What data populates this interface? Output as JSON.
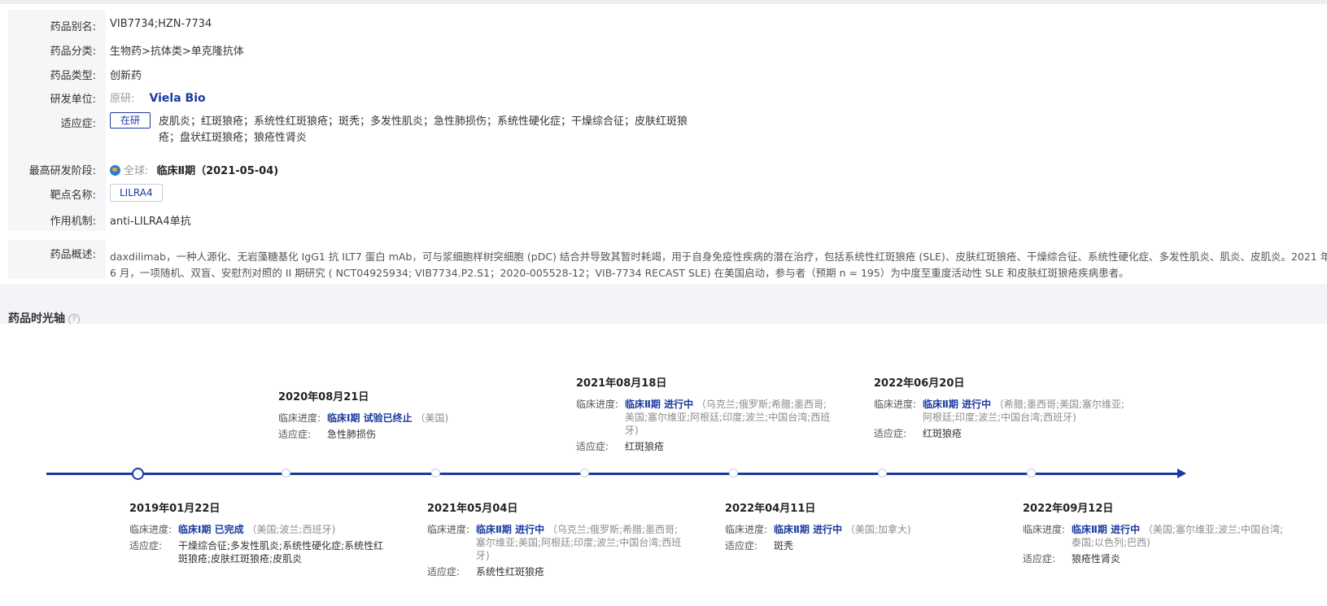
{
  "info": {
    "alias": {
      "label": "药品别名:",
      "value": "VIB7734;HZN-7734"
    },
    "category": {
      "label": "药品分类:",
      "value": "生物药>抗体类>单克隆抗体"
    },
    "type": {
      "label": "药品类型:",
      "value": "创新药"
    },
    "developer": {
      "label": "研发单位:",
      "prefix": "原研:",
      "name": "Viela Bio"
    },
    "indication": {
      "label": "适应症:",
      "tag": "在研",
      "line1": "皮肌炎；红斑狼疮；系统性红斑狼疮；斑秃；多发性肌炎；急性肺损伤；系统性硬化症；干燥综合征；皮肤红斑狼",
      "line2": "疮；盘状红斑狼疮；狼疮性肾炎"
    },
    "phase": {
      "label": "最高研发阶段:",
      "region": "全球:",
      "value": "临床Ⅱ期（2021-05-04)"
    },
    "target": {
      "label": "靶点名称:",
      "value": "LILRA4"
    },
    "mechanism": {
      "label": "作用机制:",
      "value": "anti-LILRA4单抗"
    },
    "overview": {
      "label": "药品概述:",
      "line1": "daxdilimab，一种人源化、无岩藻糖基化 IgG1 抗 ILT7 蛋白 mAb，可与浆细胞样树突细胞 (pDC) 结合并导致其暂时耗竭，用于自身免疫性疾病的潜在治疗，包括系统性红斑狼疮 (SLE)、皮肤红斑狼疮、干燥综合征、系统性硬化症、多发性肌炎、肌炎、皮肌炎。2021 年",
      "line2": "6 月，一项随机、双盲、安慰剂对照的 II 期研究 ( NCT04925934; VIB7734.P2.S1；2020-005528-12；VIB-7734 RECAST SLE) 在美国启动，参与者（预期 n = 195）为中度至重度活动性 SLE 和皮肤红斑狼疮疾病患者。"
    }
  },
  "timeline": {
    "title": "药品时光轴",
    "progress_label": "临床进度:",
    "indication_label": "适应症:",
    "events": [
      {
        "date": "2019年01月22日",
        "stage": "临床Ⅰ期 已完成",
        "countries": "（美国;波兰;西班牙)",
        "indication": "干燥综合征;多发性肌炎;系统性硬化症;系统性红斑狼疮;皮肤红斑狼疮;皮肌炎"
      },
      {
        "date": "2020年08月21日",
        "stage": "临床Ⅰ期 试验已终止",
        "countries": "（美国)",
        "indication": "急性肺损伤"
      },
      {
        "date": "2021年05月04日",
        "stage": "临床Ⅱ期 进行中",
        "countries": "（乌克兰;俄罗斯;希腊;墨西哥;塞尔维亚;美国;阿根廷;印度;波兰;中国台湾;西班牙)",
        "indication": "系统性红斑狼疮"
      },
      {
        "date": "2021年08月18日",
        "stage": "临床Ⅱ期 进行中",
        "countries": "（乌克兰;俄罗斯;希腊;墨西哥;美国;塞尔维亚;阿根廷;印度;波兰;中国台湾;西班牙)",
        "indication": "红斑狼疮"
      },
      {
        "date": "2022年04月11日",
        "stage": "临床Ⅱ期 进行中",
        "countries": "（美国;加拿大)",
        "indication": "斑秃"
      },
      {
        "date": "2022年06月20日",
        "stage": "临床Ⅱ期 进行中",
        "countries": "（希腊;墨西哥;美国;塞尔维亚;阿根廷;印度;波兰;中国台湾;西班牙)",
        "indication": "红斑狼疮"
      },
      {
        "date": "2022年09月12日",
        "stage": "临床Ⅱ期 进行中",
        "countries": "（美国;塞尔维亚;波兰;中国台湾;泰国;以色列;巴西)",
        "indication": "狼疮性肾炎"
      }
    ]
  },
  "colors": {
    "accent": "#1a3aa0",
    "muted": "#999999",
    "label_bg": "#f5f6f8"
  }
}
